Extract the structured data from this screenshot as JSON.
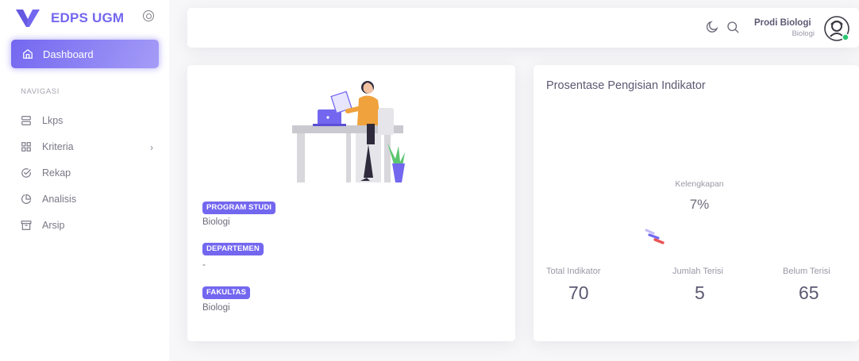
{
  "brand": {
    "name": "EDPS UGM",
    "color": "#7367f0"
  },
  "sidebar": {
    "active_item": {
      "label": "Dashboard",
      "icon": "home-icon"
    },
    "section_header": "NAVIGASI",
    "items": [
      {
        "label": "Lkps",
        "icon": "server-icon"
      },
      {
        "label": "Kriteria",
        "icon": "grid-icon",
        "has_submenu": true
      },
      {
        "label": "Rekap",
        "icon": "check-circle-icon"
      },
      {
        "label": "Analisis",
        "icon": "pie-chart-icon"
      },
      {
        "label": "Arsip",
        "icon": "archive-icon"
      }
    ]
  },
  "navbar": {
    "user_name": "Prodi Biologi",
    "user_role": "Biologi",
    "icons": [
      "moon-icon",
      "search-icon"
    ],
    "status_color": "#28c76f"
  },
  "profile_card": {
    "fields": [
      {
        "label": "PROGRAM STUDI",
        "value": "Biologi"
      },
      {
        "label": "DEPARTEMEN",
        "value": "-"
      },
      {
        "label": "FAKULTAS",
        "value": "Biologi"
      }
    ]
  },
  "progress_card": {
    "title": "Prosentase Pengisian Indikator",
    "completeness_label": "Kelengkapan",
    "completeness_value": "7%",
    "completeness_fraction": 0.07,
    "stats": [
      {
        "label": "Total Indikator",
        "value": "70"
      },
      {
        "label": "Jumlah Terisi",
        "value": "5"
      },
      {
        "label": "Belum Terisi",
        "value": "65"
      }
    ]
  }
}
